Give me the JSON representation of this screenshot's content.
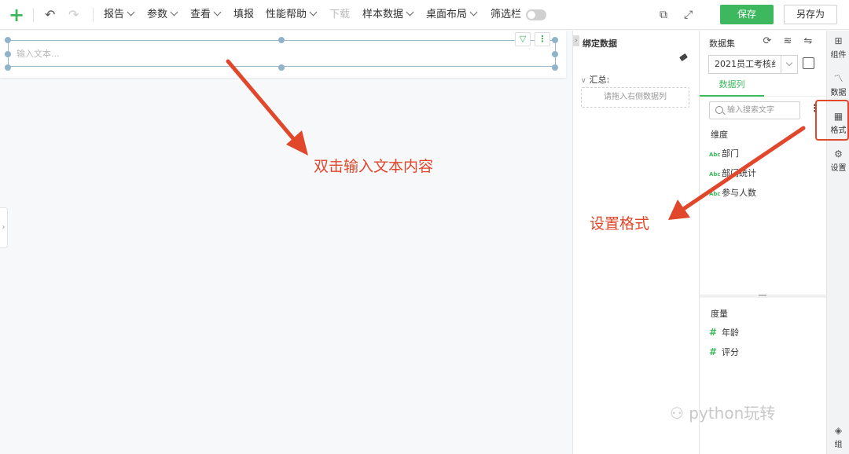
{
  "toolbar": {
    "add_icon": "plus-icon",
    "undo_icon": "undo-icon",
    "redo_icon": "redo-icon",
    "menus": {
      "report": "报告",
      "params": "参数",
      "view": "查看",
      "fill": "填报",
      "perf_help": "性能帮助",
      "download": "下载",
      "sample_data": "样本数据",
      "desktop_layout": "桌面布局",
      "filter_bar": "筛选栏"
    },
    "filter_bar_on": false,
    "save_label": "保存",
    "save_as_label": "另存为",
    "accent_color": "#3eb85f"
  },
  "canvas": {
    "text_placeholder": "输入文本..."
  },
  "bind_panel": {
    "title": "绑定数据",
    "summary_label": "汇总:",
    "drop_hint": "请拖入右侧数据列"
  },
  "data_panel": {
    "dataset_label": "数据集",
    "dataset_value": "2021员工考核纟",
    "columns_tab": "数据列",
    "search_placeholder": "输入搜索文字",
    "dimension_title": "维度",
    "dimensions": [
      {
        "type": "Abc",
        "name": "部门"
      },
      {
        "type": "Abc",
        "name": "部门统计"
      },
      {
        "type": "Abc",
        "name": "参与人数"
      }
    ],
    "measure_title": "度量",
    "measures": [
      {
        "type": "#",
        "name": "年龄"
      },
      {
        "type": "#",
        "name": "评分"
      }
    ]
  },
  "right_rail": {
    "component": "组件",
    "data": "数据",
    "format": "格式",
    "settings": "设置",
    "group": "组"
  },
  "annotations": {
    "text1": "双击输入文本内容",
    "text2": "设置格式",
    "color": "#e0472b"
  },
  "watermark": "python玩转"
}
